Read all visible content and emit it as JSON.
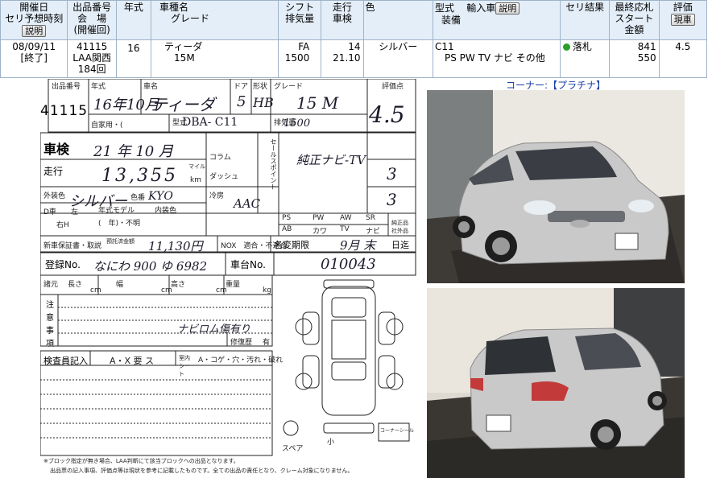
{
  "header": {
    "col1_line1": "開催日",
    "col1_line2": "セリ予想時刻",
    "col2_line1": "出品番号",
    "col2_line2": "会　場",
    "col2_line3": "(開催回)",
    "col3": "年式",
    "col4_line1": "車種名",
    "col4_line2": "グレード",
    "col5_line1": "シフト",
    "col5_line2": "排気量",
    "col6_line1": "走行",
    "col6_line2": "車検",
    "col7": "色",
    "col8_line1": "型式",
    "col8_import": "輸入車",
    "col8_line2": "装備",
    "col9": "セリ結果",
    "col10_line1": "最終応札",
    "col10_line2": "スタート金額",
    "col11": "評価",
    "explain_btn": "説明",
    "eval_btn": "現車"
  },
  "row": {
    "date": "08/09/11",
    "time": "[終了]",
    "lot": "41115",
    "venue": "LAA関西",
    "session": "184回",
    "year": "16",
    "model": "ティーダ",
    "grade": "15M",
    "shift": "FA",
    "cc": "1500",
    "mileage": "14",
    "inspection": "21.10",
    "color": "シルバー",
    "type_code": "C11",
    "equipment": "PS PW TV ナビ その他",
    "result": "落札",
    "final_bid": "841",
    "start_price": "550",
    "score": "4.5",
    "result_color": "#2aa02a"
  },
  "corner_text": "コーナー:【プラチナ】",
  "sheet": {
    "lot_label": "出品番号",
    "lot_no": "41115",
    "year_label": "年式",
    "year_hw": "16年10月",
    "name_label": "車名",
    "name_hw": "ティーダ",
    "door_label": "ドア",
    "door_hw": "5",
    "shape_label": "形状",
    "shape_hw": "HB",
    "grade_label": "グレード",
    "grade_hw": "15 M",
    "score_label": "評価点",
    "score_hw": "4.5",
    "use_label": "自家用・(",
    "type_label": "型式",
    "type_hw": "DBA- C11",
    "cc_label": "排気量",
    "cc_hw": "1500",
    "inspect_label": "車検",
    "inspect_hw": "21 年 10 月",
    "mileage_label": "走行",
    "mileage_hw": "13,355",
    "km": "km",
    "mile": "マイル",
    "color_label": "外装色",
    "color_hw": "シルバー",
    "colorno_label": "色番",
    "colorno_hw": "KYO",
    "model_year_label": "年式モデル",
    "model_year": "(　年)・不明",
    "interior_label": "内装色",
    "d_label": "D車",
    "left_label": "左",
    "right_label": "右H",
    "column_label": "コラム",
    "dash_label": "ダッシュ",
    "cool_label": "冷房",
    "cool_hw": "AAC",
    "sel_label": "セールスポイント",
    "sales_hw": "純正ナビ-TV",
    "score2_hw": "3",
    "score3_hw": "3",
    "equip": [
      "PS",
      "PW",
      "AW",
      "SR",
      "AB",
      "カワ",
      "TV",
      "ナビ"
    ],
    "equip_extra": "純正品 社外品",
    "recycle_label": "新車保証書・取説",
    "recycle_fee_label": "預託済金額",
    "recycle_hw": "11,130円",
    "nox_label": "NOX　適合・不適合",
    "change_label": "名変期限",
    "change_hw": "9月 末",
    "change_note": "日迄",
    "reg_label": "登録No.",
    "reg_hw": "なにわ 900 ゆ 6982",
    "chassis_label": "車台No.",
    "chassis_hw": "010043",
    "spec_label": "諸元",
    "length_label": "長さ",
    "cm": "cm",
    "width_label": "幅",
    "height_label": "高さ",
    "weight_label": "重量",
    "kg": "kg",
    "notes_label_1": "注",
    "notes_label_2": "意",
    "notes_label_3": "事",
    "notes_label_4": "項",
    "notes_hw": "ナビロム傷有り",
    "repair_label": "修復歴",
    "repair_yes": "有",
    "inspector_label": "検査員記入",
    "inspector_opts": "A・X 要 ス",
    "seat_label": "室内シート",
    "seat_opts": "A・コゲ・穴・汚れ・破れ",
    "spare_label": "スペア",
    "small_label": "小",
    "footer_1": "※ブロック指定が無き場合、LAA判断にて該当ブロックへの出品となります。",
    "footer_2": "出品票の記入事項、評価点等は現状を参考に記載したものです。全ての出品の責任となり、クレーム対象になりません。",
    "stamp": "コーナーシール"
  }
}
